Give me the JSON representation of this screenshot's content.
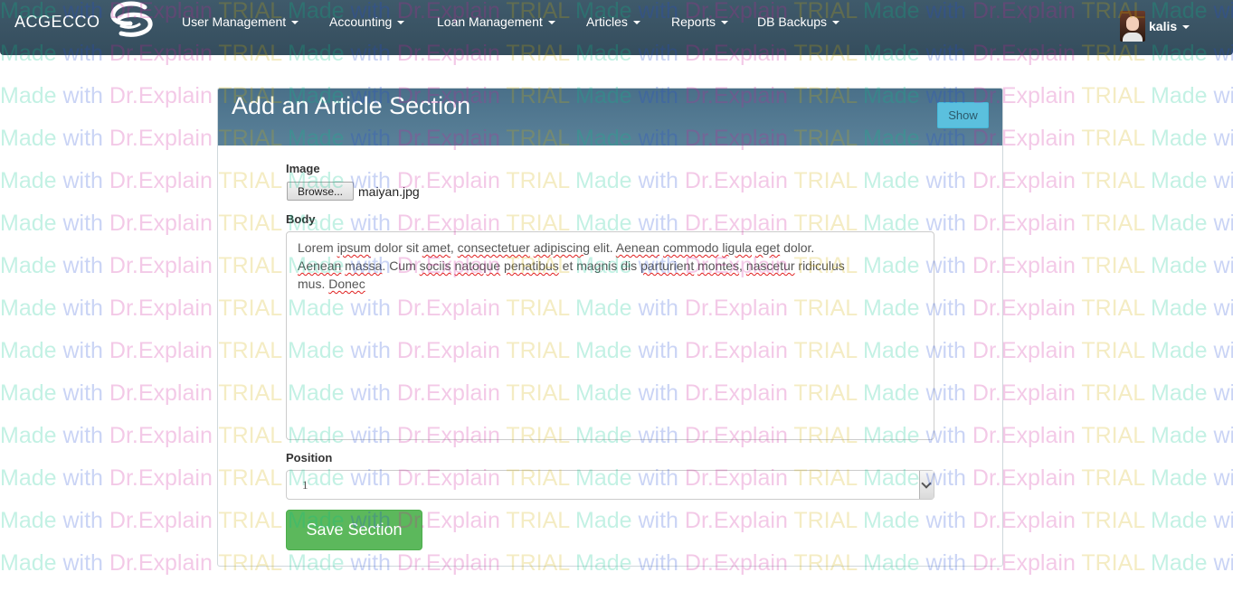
{
  "navbar": {
    "brand": "ACGECCO",
    "menu": [
      {
        "label": "User Management"
      },
      {
        "label": "Accounting"
      },
      {
        "label": "Loan Management"
      },
      {
        "label": "Articles"
      },
      {
        "label": "Reports"
      },
      {
        "label": "DB Backups"
      }
    ],
    "user": {
      "name": "kalis"
    }
  },
  "panel": {
    "title": "Add an Article Section",
    "show_button": "Show"
  },
  "form": {
    "image_label": "Image",
    "browse_button": "Browse...",
    "file_name": "maiyan.jpg",
    "body_label": "Body",
    "body_lines": [
      "Lorem ipsum dolor sit amet, consectetuer adipiscing elit. Aenean commodo ligula eget dolor.",
      "Aenean massa. Cum sociis natoque penatibus et magnis dis parturient montes, nascetur ridiculus",
      "mus. Donec"
    ],
    "position_label": "Position",
    "position_value": "1",
    "save_button": "Save Section"
  },
  "watermark": {
    "made": "Made",
    "with": "with",
    "dr": "Dr.Explain",
    "trial": "TRIAL"
  },
  "colors": {
    "navbar": "#3c5566",
    "panel_heading": "#527a92",
    "show_button": "#5bc0de",
    "save_button": "#5cb85c"
  }
}
